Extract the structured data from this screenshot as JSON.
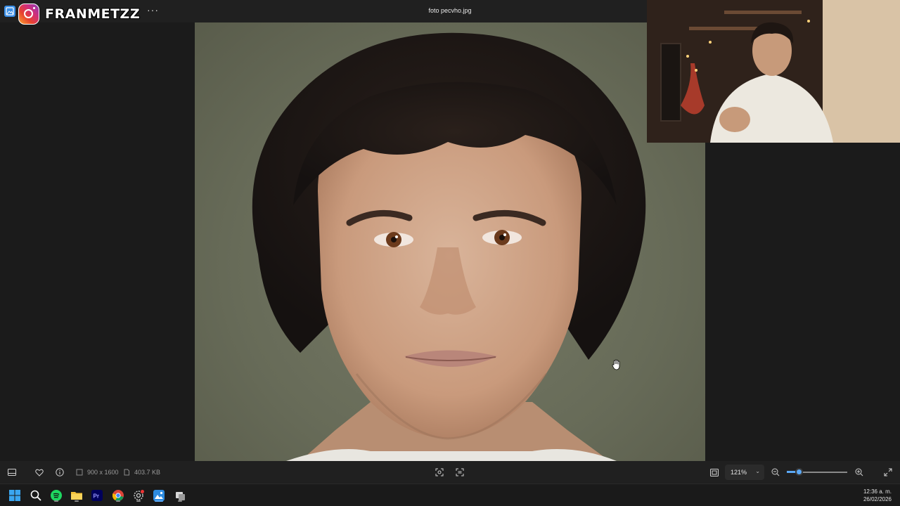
{
  "window": {
    "title": "foto pecvho.jpg",
    "more_label": "···"
  },
  "overlay": {
    "handle": "FRANMETZZ"
  },
  "statusbar": {
    "dimensions": "900 x 1600",
    "filesize": "403.7 KB",
    "zoom": "121%",
    "zoom_fraction": 0.2
  },
  "taskbar": {
    "apps": [
      "start",
      "search",
      "spotify",
      "file-explorer",
      "premiere-pro",
      "chrome",
      "settings",
      "photos",
      "app"
    ],
    "time": "12:36 a. m.",
    "date": "26/02/2026"
  },
  "colors": {
    "accent": "#5ba8f5",
    "background": "#1b1b1b",
    "toolbar": "#202020"
  }
}
